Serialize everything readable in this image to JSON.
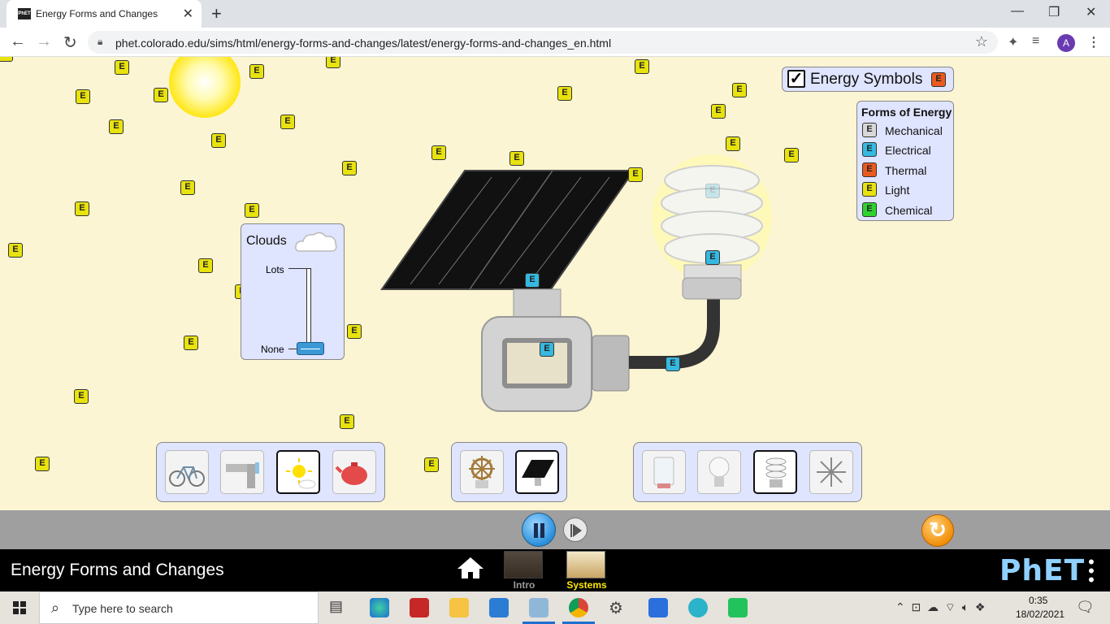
{
  "browser": {
    "tab_title": "Energy Forms and Changes",
    "tab_close": "✕",
    "new_tab": "+",
    "url": "phet.colorado.edu/sims/html/energy-forms-and-changes/latest/energy-forms-and-changes_en.html",
    "avatar_initial": "A",
    "favicon_text": "PhET"
  },
  "sim": {
    "chip_letter": "E",
    "clouds": {
      "title": "Clouds",
      "lots_label": "Lots",
      "none_label": "None",
      "level": 0
    },
    "energy_symbols": {
      "label": "Energy Symbols",
      "checked": true
    },
    "forms_of_energy": {
      "title": "Forms of Energy",
      "items": [
        {
          "label": "Mechanical",
          "color": "#d8d8d8"
        },
        {
          "label": "Electrical",
          "color": "#35b9e0"
        },
        {
          "label": "Thermal",
          "color": "#ea5a1e"
        },
        {
          "label": "Light",
          "color": "#e8e20e"
        },
        {
          "label": "Chemical",
          "color": "#2fd22f"
        }
      ]
    },
    "sources": [
      "bicycle",
      "faucet",
      "sun",
      "teapot"
    ],
    "selected_source": "sun",
    "converters": [
      "generator",
      "solar-panel"
    ],
    "selected_converter": "solar-panel",
    "users": [
      "water-beaker",
      "incandescent-bulb",
      "fluorescent-bulb",
      "fan"
    ],
    "selected_user": "fluorescent-bulb"
  },
  "nav": {
    "title": "Energy Forms and Changes",
    "screens": [
      {
        "label": "Intro",
        "selected": false
      },
      {
        "label": "Systems",
        "selected": true
      }
    ],
    "logo": "PhET"
  },
  "taskbar": {
    "search_placeholder": "Type here to search",
    "time": "0:35",
    "date": "18/02/2021"
  }
}
